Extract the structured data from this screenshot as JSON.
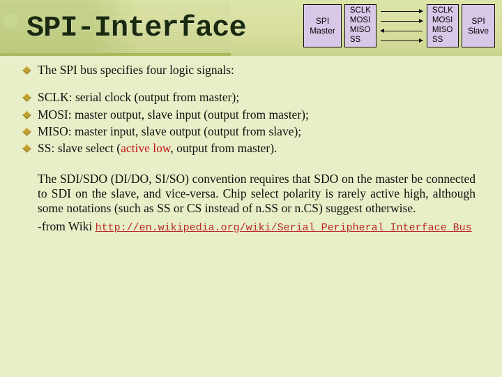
{
  "header": {
    "title": "SPI-Interface"
  },
  "diagram": {
    "master_label": "SPI\nMaster",
    "slave_label": "SPI\nSlave",
    "pins": [
      "SCLK",
      "MOSI",
      "MISO",
      "SS"
    ]
  },
  "bullets_intro": [
    "The SPI bus specifies four logic signals:"
  ],
  "bullets_signals": [
    {
      "name": "SCLK",
      "desc": ": serial clock (output from master);"
    },
    {
      "name": "MOSI",
      "desc": ": master output, slave input (output from master);"
    },
    {
      "name": "MISO",
      "desc": ": master input, slave output (output from slave);"
    },
    {
      "name": "SS",
      "desc_pre": ": slave select (",
      "active_low": "active low",
      "desc_post": ", output from master)."
    }
  ],
  "paragraph": "The SDI/SDO (DI/DO, SI/SO) convention requires that SDO on the master be connected to SDI on the slave, and vice-versa. Chip select polarity is rarely active high, although some notations (such as SS or CS instead of n.SS or n.CS) suggest otherwise.",
  "source": {
    "prefix": "-from Wiki ",
    "link_text": "http://en.wikipedia.org/wiki/Serial_Peripheral_Interface_Bus"
  }
}
